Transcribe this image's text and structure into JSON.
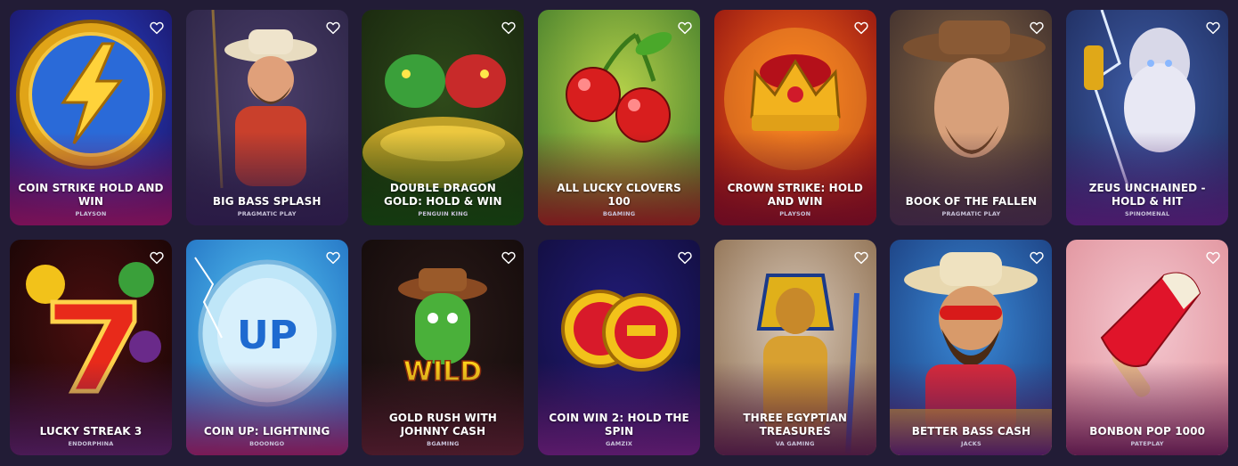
{
  "games": [
    {
      "title": "COIN STRIKE HOLD AND WIN",
      "provider": "PLAYSON",
      "icon": "lightning-coin-icon",
      "bg": [
        "#2a49d8",
        "#1a1260"
      ],
      "shade": "#7a1156"
    },
    {
      "title": "BIG BASS SPLASH",
      "provider": "PRAGMATIC PLAY",
      "icon": "fisherman-icon",
      "bg": [
        "#4b3f6b",
        "#2b2344"
      ],
      "shade": "#2a1a45"
    },
    {
      "title": "DOUBLE DRAGON GOLD: HOLD & WIN",
      "provider": "PENGUIN KING",
      "icon": "dragons-icon",
      "bg": [
        "#2f4a1a",
        "#18250e"
      ],
      "shade": "#143a10"
    },
    {
      "title": "ALL LUCKY CLOVERS 100",
      "provider": "BGAMING",
      "icon": "cherry-icon",
      "bg": [
        "#b7d24a",
        "#3f7a2a"
      ],
      "shade": "#7a1a1e"
    },
    {
      "title": "CROWN STRIKE: HOLD AND WIN",
      "provider": "PLAYSON",
      "icon": "crown-icon",
      "bg": [
        "#ff6a1a",
        "#8a0f10"
      ],
      "shade": "#6a0c22"
    },
    {
      "title": "BOOK OF THE FALLEN",
      "provider": "PRAGMATIC PLAY",
      "icon": "cowboy-icon",
      "bg": [
        "#8a6a4a",
        "#3a2b2a"
      ],
      "shade": "#3b2440"
    },
    {
      "title": "ZEUS UNCHAINED - HOLD & HIT",
      "provider": "SPINOMENAL",
      "icon": "zeus-icon",
      "bg": [
        "#3f5ea8",
        "#1d2a5a"
      ],
      "shade": "#4a1a6a"
    },
    {
      "title": "LUCKY STREAK 3",
      "provider": "ENDORPHINA",
      "icon": "lucky-seven-icon",
      "bg": [
        "#4a0f0f",
        "#150505"
      ],
      "shade": "#4a1a55"
    },
    {
      "title": "COIN UP: LIGHTNING",
      "provider": "BOOONGO",
      "icon": "up-coin-icon",
      "bg": [
        "#58c8f4",
        "#1f6cc0"
      ],
      "shade": "#7a1a55"
    },
    {
      "title": "GOLD RUSH WITH JOHNNY CASH",
      "provider": "BGAMING",
      "icon": "cactus-wild-icon",
      "bg": [
        "#2a1a18",
        "#120a0a"
      ],
      "shade": "#4a1a2a"
    },
    {
      "title": "COIN WIN 2: HOLD THE SPIN",
      "provider": "GAMZIX",
      "icon": "gold-coins-icon",
      "bg": [
        "#221c7a",
        "#110d3a"
      ],
      "shade": "#5a1a6a"
    },
    {
      "title": "THREE EGYPTIAN TREASURES",
      "provider": "VA GAMING",
      "icon": "pharaoh-icon",
      "bg": [
        "#d8c8b8",
        "#8a6a4a"
      ],
      "shade": "#4a1a40"
    },
    {
      "title": "BETTER BASS CASH",
      "provider": "JACKS",
      "icon": "bearded-man-icon",
      "bg": [
        "#3a8ad8",
        "#1a3a7a"
      ],
      "shade": "#4a1a5a"
    },
    {
      "title": "BONBON POP 1000",
      "provider": "PATEPLAY",
      "icon": "popsicle-icon",
      "bg": [
        "#f4c8d0",
        "#e0909a"
      ],
      "shade": "#5a1a4a"
    }
  ]
}
